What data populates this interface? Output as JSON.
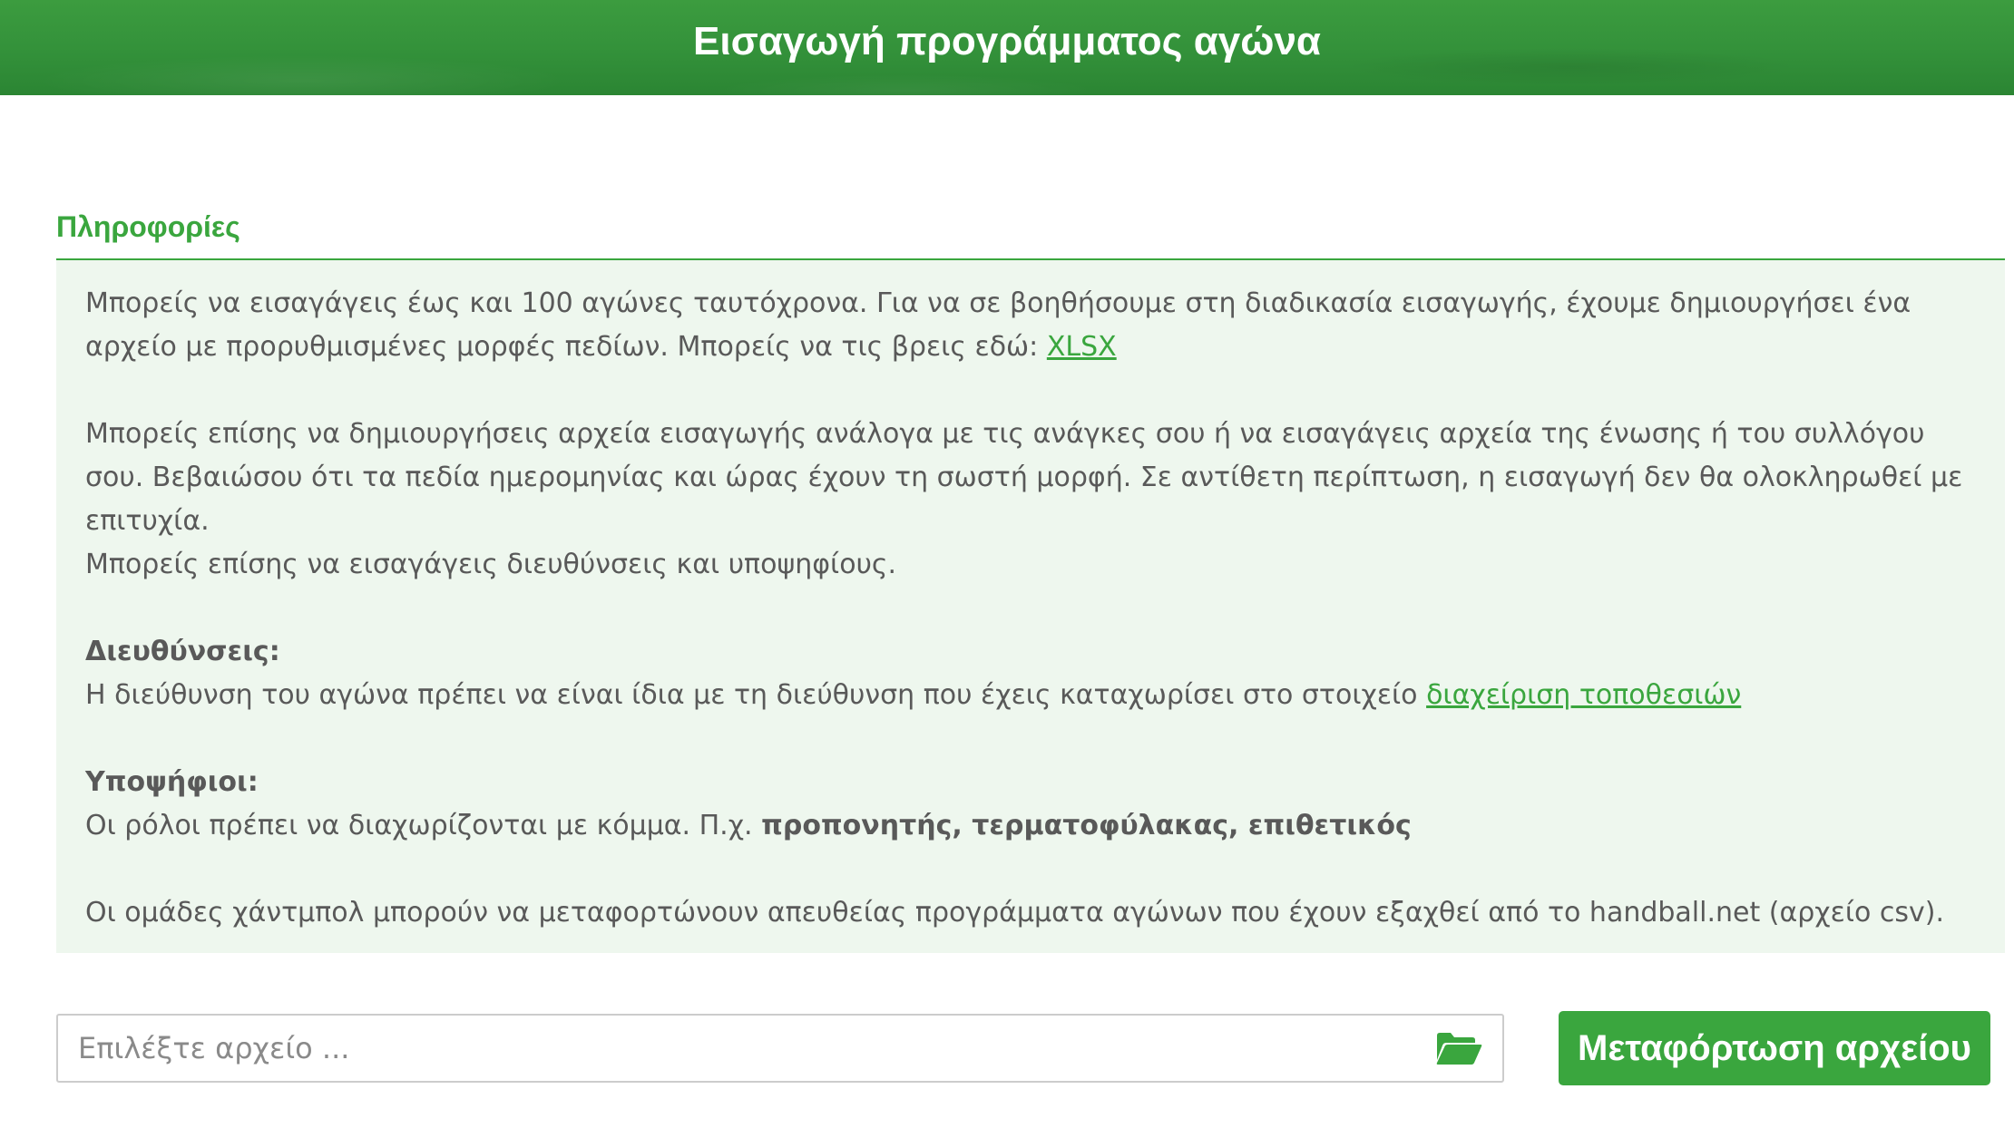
{
  "header": {
    "title": "Εισαγωγή προγράμματος αγώνα"
  },
  "info": {
    "section_title": "Πληροφορίες",
    "p1_text": "Μπορείς να εισαγάγεις έως και 100 αγώνες ταυτόχρονα. Για να σε βοηθήσουμε στη διαδικασία εισαγωγής, έχουμε δημιουργήσει ένα αρχείο με προρυθμισμένες μορφές πεδίων. Μπορείς να τις βρεις εδώ: ",
    "p1_link": "XLSX",
    "p2_text": "Μπορείς επίσης να δημιουργήσεις αρχεία εισαγωγής ανάλογα με τις ανάγκες σου ή να εισαγάγεις αρχεία της ένωσης ή του συλλόγου σου. Βεβαιώσου ότι τα πεδία ημερομηνίας και ώρας έχουν τη σωστή μορφή. Σε αντίθετη περίπτωση, η εισαγωγή δεν θα ολοκληρωθεί με επιτυχία.",
    "p3_text": "Μπορείς επίσης να εισαγάγεις διευθύνσεις και υποψηφίους.",
    "addresses_heading": "Διευθύνσεις:",
    "addresses_text": "Η διεύθυνση του αγώνα πρέπει να είναι ίδια με τη διεύθυνση που έχεις καταχωρίσει στο στοιχείο ",
    "addresses_link": "διαχείριση τοποθεσιών",
    "candidates_heading": "Υποψήφιοι:",
    "candidates_text": "Οι ρόλοι πρέπει να διαχωρίζονται με κόμμα. Π.χ. ",
    "candidates_example": "προπονητής, τερματοφύλακας, επιθετικός",
    "handball_text": "Οι ομάδες χάντμπολ μπορούν να μεταφορτώνουν απευθείας προγράμματα αγώνων που έχουν εξαχθεί από το handball.net (αρχείο csv)."
  },
  "file_picker": {
    "placeholder": "Επιλέξτε αρχείο ...",
    "icon": "folder-open-icon"
  },
  "upload_button": {
    "label": "Μεταφόρτωση αρχείου"
  },
  "colors": {
    "accent": "#3aa63e",
    "info_bg": "#eef7ee",
    "header_bg": "#33913a"
  }
}
